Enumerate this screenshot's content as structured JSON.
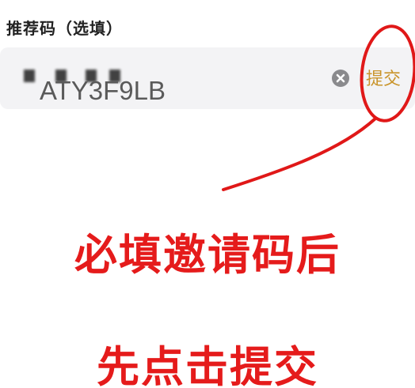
{
  "form": {
    "label": "推荐码（选填）",
    "code_value": "ATY3F9LB",
    "submit_label": "提交"
  },
  "icons": {
    "clear": "clear-circle-x-icon"
  },
  "annotations": {
    "line1": "必填邀请码后",
    "line2": "先点击提交",
    "color": "#e51b1b"
  },
  "colors": {
    "submit": "#c9942a",
    "input_bg": "#f3f3f5"
  }
}
